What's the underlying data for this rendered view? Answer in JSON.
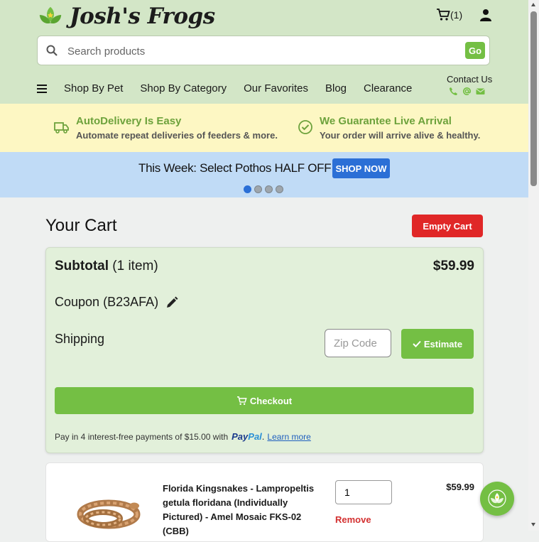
{
  "header": {
    "brand": "Josh's Frogs",
    "cart_count": "(1)",
    "search_placeholder": "Search products",
    "search_button": "Go",
    "contact": "Contact Us"
  },
  "nav": {
    "items": [
      "Shop By Pet",
      "Shop By Category",
      "Our Favorites",
      "Blog",
      "Clearance"
    ]
  },
  "promos": [
    {
      "title": "AutoDelivery Is Easy",
      "subtitle": "Automate repeat deliveries of feeders & more."
    },
    {
      "title": "We Guarantee Live Arrival",
      "subtitle": "Your order will arrive alive & healthy."
    }
  ],
  "banner": {
    "text": "This Week: Select Pothos HALF OFF",
    "button": "SHOP NOW"
  },
  "cart": {
    "title": "Your Cart",
    "empty_button": "Empty Cart",
    "subtotal_label": "Subtotal",
    "subtotal_count": "(1 item)",
    "subtotal_value": "$59.99",
    "coupon_label": "Coupon",
    "coupon_code": "(B23AFA)",
    "shipping_label": "Shipping",
    "zip_placeholder": "Zip Code",
    "estimate_button": "Estimate",
    "checkout_button": "Checkout",
    "paypal_text": "Pay in 4 interest-free payments of $15.00 with",
    "paypal_brand_1": "Pay",
    "paypal_brand_2": "Pal",
    "paypal_period": ".",
    "learn_more": "Learn more"
  },
  "item": {
    "name": "Florida Kingsnakes - Lampropeltis getula floridana (Individually Pictured) - Amel Mosaic FKS-02 (CBB)",
    "quantity": "1",
    "remove": "Remove",
    "price": "$59.99"
  },
  "colors": {
    "header_bg": "#d3e6c7",
    "brand_green": "#74bf44",
    "promo_bg": "#fdf7c3",
    "banner_bg": "#c0dbf6",
    "button_blue": "#2b6fd6",
    "danger_red": "#e02727"
  },
  "icons": [
    "leaf-logo-icon",
    "cart-icon",
    "user-icon",
    "search-icon",
    "menu-icon",
    "phone-icon",
    "at-icon",
    "mail-icon",
    "truck-icon",
    "check-circle-icon",
    "pencil-icon",
    "check-icon",
    "chat-leaf-icon"
  ]
}
